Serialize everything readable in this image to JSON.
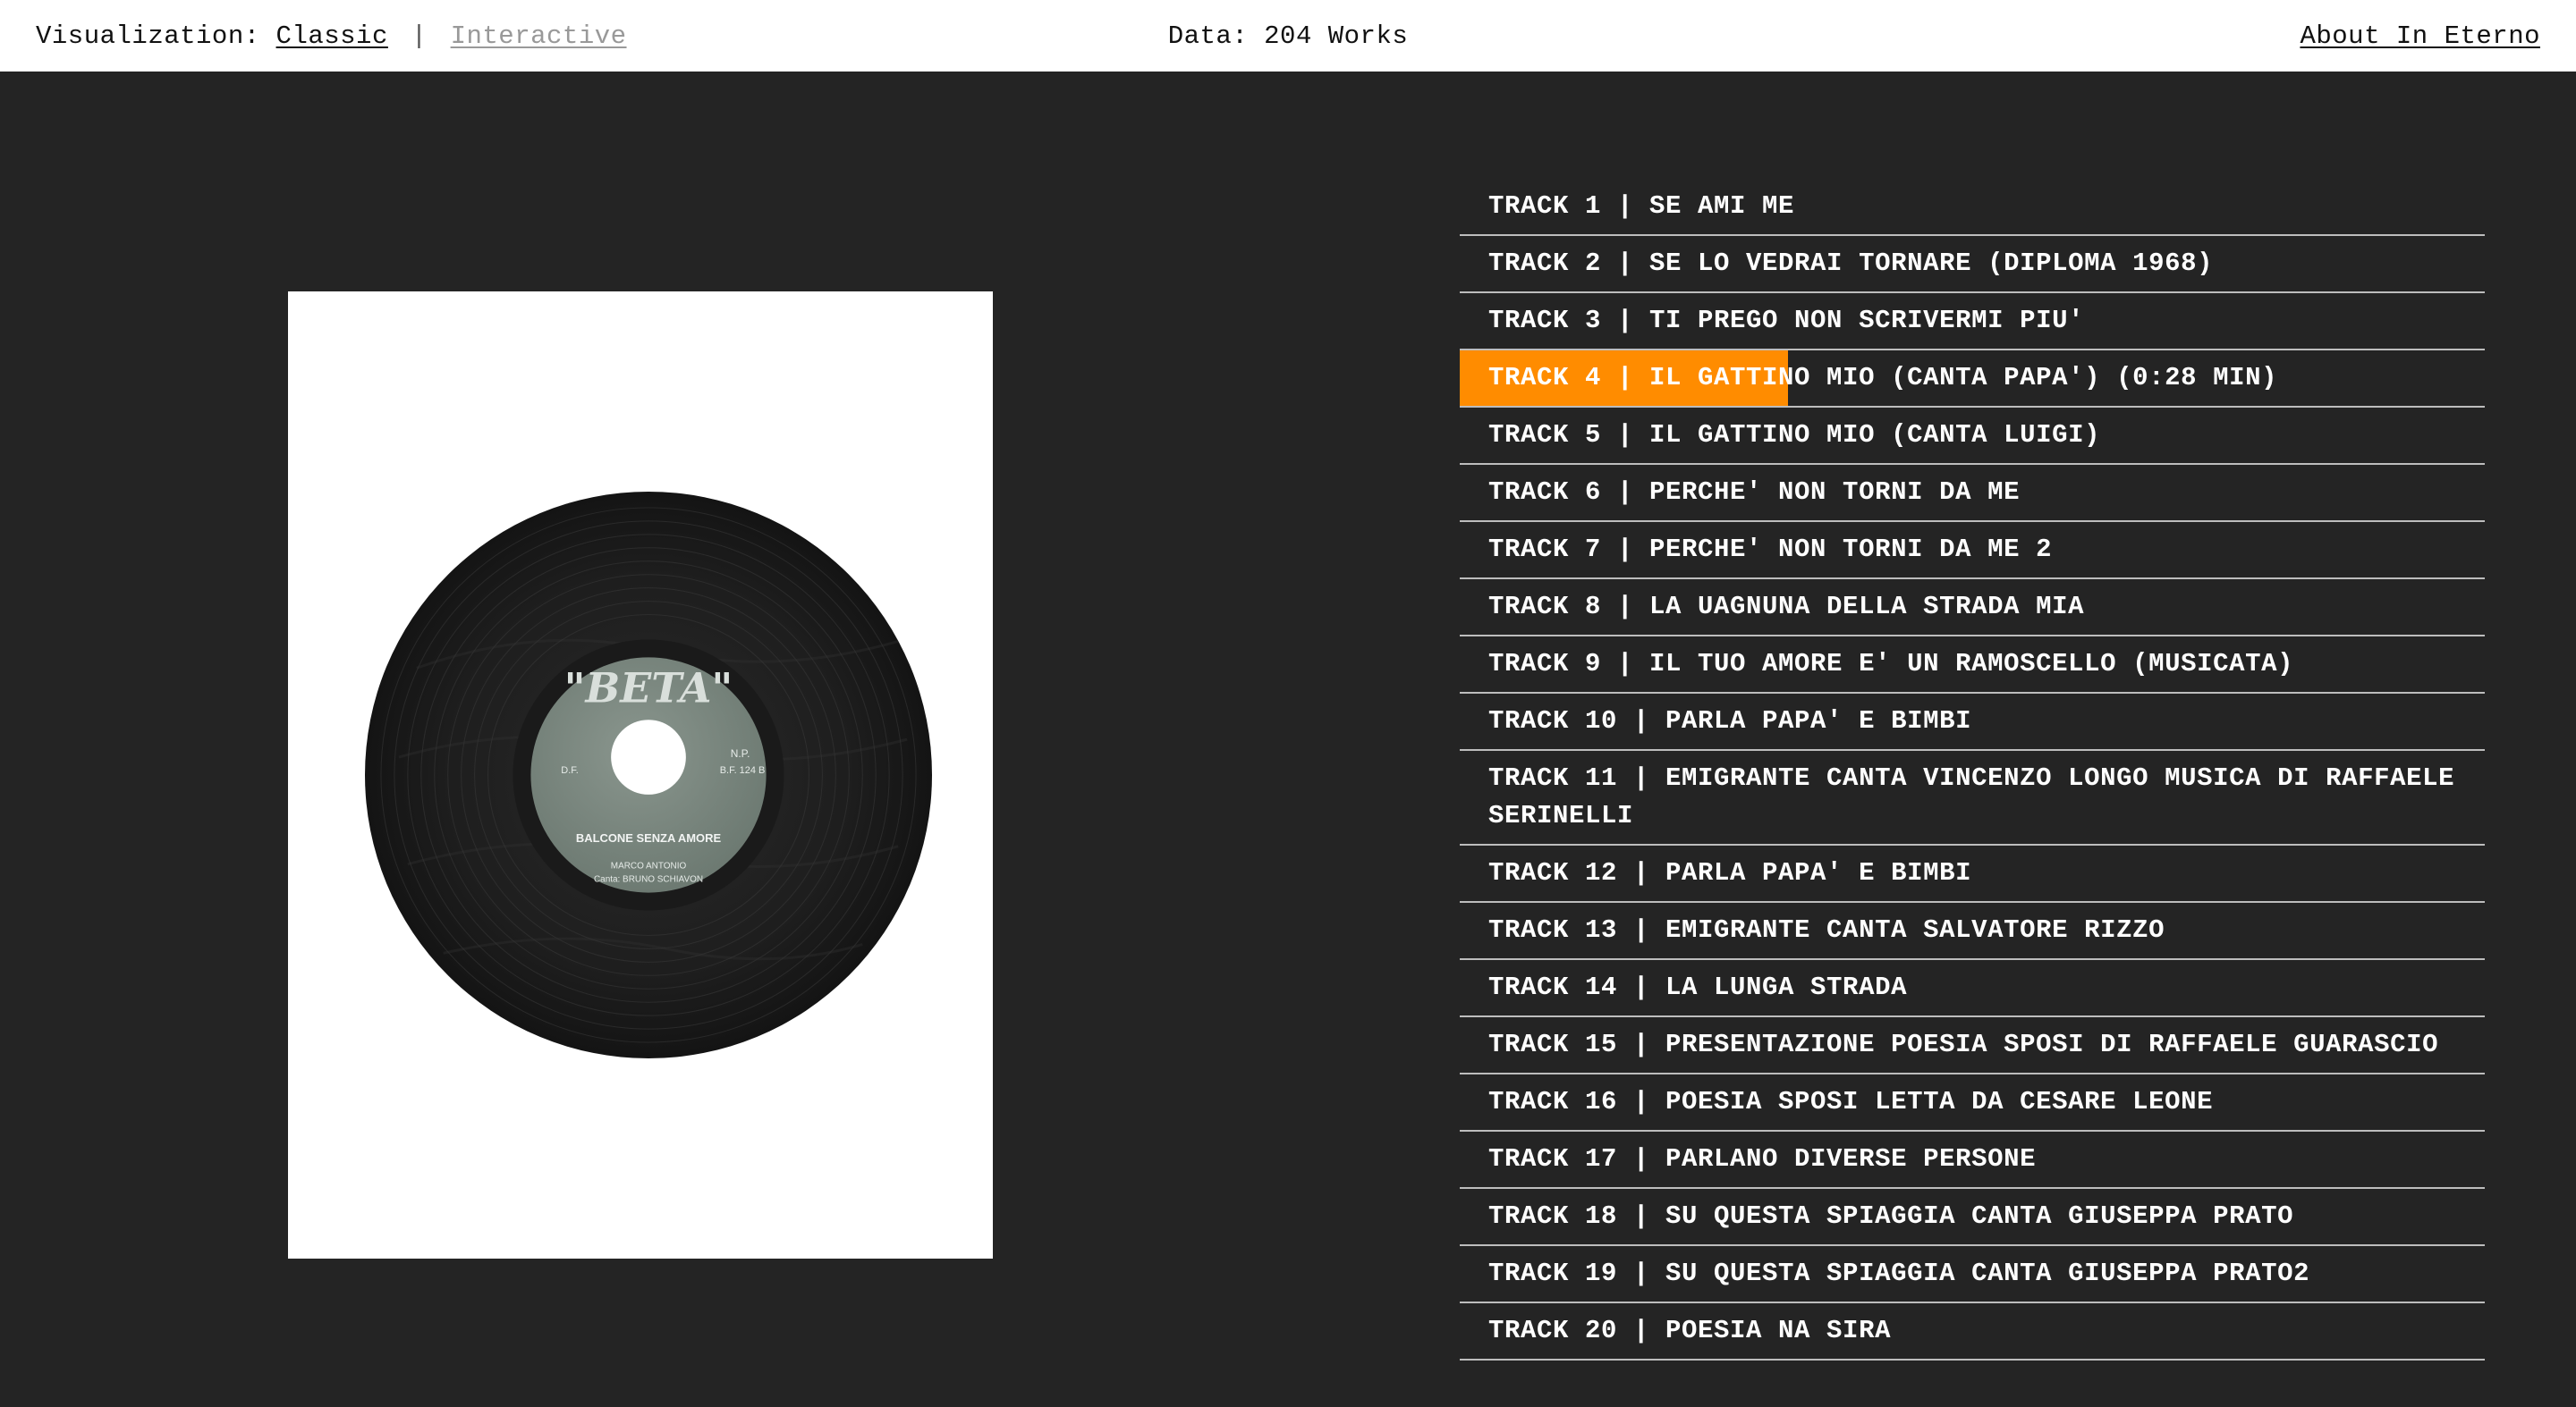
{
  "header": {
    "visualization_label": "Visualization:",
    "classic_link": "Classic",
    "separator": "|",
    "interactive_link": "Interactive",
    "data_label": "Data: 204 Works",
    "about_link": "About In Eterno"
  },
  "record": {
    "label_brand": "\"BETA\"",
    "label_left_code": "D.F.",
    "label_right_code": "N.P.",
    "label_catalog": "B.F. 124 B",
    "label_song": "BALCONE SENZA AMORE",
    "label_performer": "MARCO ANTONIO",
    "label_singer": "Canta: BRUNO SCHIAVON"
  },
  "colors": {
    "background": "#242424",
    "active_track": "#ff8c00",
    "divider": "#bdbdbd"
  },
  "tracks": [
    {
      "label": "TRACK 1 | SE AMI ME"
    },
    {
      "label": "TRACK 2 | SE LO VEDRAI TORNARE (DIPLOMA 1968)"
    },
    {
      "label": "TRACK 3 | TI PREGO NON SCRIVERMI PIU'"
    },
    {
      "label": "TRACK 4 | IL GATTINO MIO (CANTA PAPA') (0:28 MIN)",
      "active": true,
      "progress": 0.32
    },
    {
      "label": "TRACK 5 | IL GATTINO MIO (CANTA LUIGI)"
    },
    {
      "label": "TRACK 6 | PERCHE' NON TORNI DA ME"
    },
    {
      "label": "TRACK 7 | PERCHE' NON TORNI DA ME 2"
    },
    {
      "label": "TRACK 8 | LA UAGNUNA DELLA STRADA MIA"
    },
    {
      "label": "TRACK 9 | IL TUO AMORE E' UN RAMOSCELLO (MUSICATA)"
    },
    {
      "label": "TRACK 10 | PARLA PAPA' E BIMBI"
    },
    {
      "label": "TRACK 11 | EMIGRANTE CANTA VINCENZO LONGO MUSICA DI RAFFAELE SERINELLI"
    },
    {
      "label": "TRACK 12 | PARLA PAPA' E BIMBI"
    },
    {
      "label": "TRACK 13 | EMIGRANTE CANTA SALVATORE RIZZO"
    },
    {
      "label": "TRACK 14 | LA LUNGA STRADA"
    },
    {
      "label": "TRACK 15 | PRESENTAZIONE POESIA SPOSI DI RAFFAELE GUARASCIO"
    },
    {
      "label": "TRACK 16 | POESIA SPOSI LETTA DA CESARE LEONE"
    },
    {
      "label": "TRACK 17 | PARLANO DIVERSE PERSONE"
    },
    {
      "label": "TRACK 18 | SU QUESTA SPIAGGIA CANTA GIUSEPPA PRATO"
    },
    {
      "label": "TRACK 19 | SU QUESTA SPIAGGIA CANTA GIUSEPPA PRATO2"
    },
    {
      "label": "TRACK 20 | POESIA NA SIRA"
    }
  ]
}
